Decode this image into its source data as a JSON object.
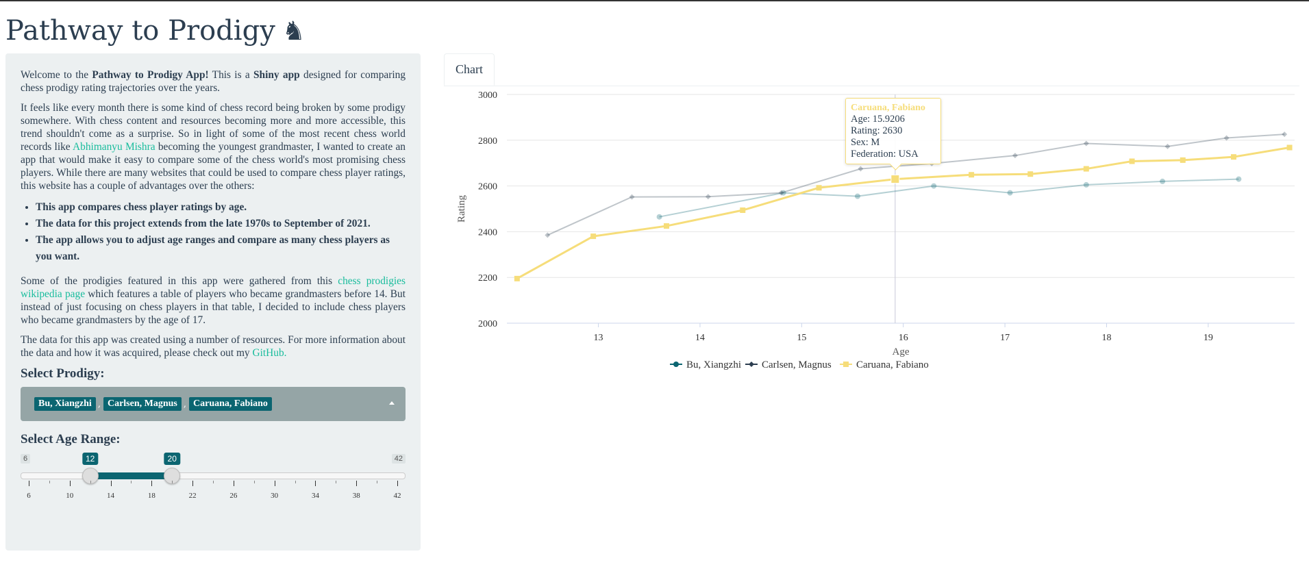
{
  "app": {
    "title": "Pathway to Prodigy",
    "icon": "chess-knight-icon"
  },
  "sidebar": {
    "intro_prefix": "Welcome to the ",
    "intro_app_name": "Pathway to Prodigy App!",
    "intro_mid": " This is a ",
    "intro_shiny": "Shiny app",
    "intro_suffix": " designed for comparing chess prodigy rating trajectories over the years.",
    "para2_before_link": "It feels like every month there is some kind of chess record being broken by some prodigy somewhere. With chess content and resources becoming more and more accessible, this trend shouldn't come as a surprise. So in light of some of the most recent chess world records like ",
    "para2_link": "Abhimanyu Mishra",
    "para2_after_link": " becoming the youngest grandmaster, I wanted to create an app that would make it easy to compare some of the chess world's most promising chess players. While there are many websites that could be used to compare chess player ratings, this website has a couple of advantages over the others:",
    "features": [
      "This app compares chess player ratings by age.",
      "The data for this project extends from the late 1970s to September of 2021.",
      "The app allows you to adjust age ranges and compare as many chess players as you want."
    ],
    "para3_before_link": "Some of the prodigies featured in this app were gathered from this ",
    "para3_link": "chess prodigies wikipedia page",
    "para3_after_link": " which features a table of players who became grandmasters before 14. But instead of just focusing on chess players in that table, I decided to include chess players who became grandmasters by the age of 17.",
    "para4_text": "The data for this app was created using a number of resources. For more information about the data and how it was acquired, please check out my ",
    "para4_link": "GitHub.",
    "select_prodigy_label": "Select Prodigy:",
    "selected_prodigies": [
      "Bu, Xiangzhi",
      "Carlsen, Magnus",
      "Caruana, Fabiano"
    ],
    "age_range_label": "Select Age Range:",
    "age_slider": {
      "min": 6,
      "max": 42,
      "from": 12,
      "to": 20,
      "min_label": "6",
      "max_label": "42",
      "from_label": "12",
      "to_label": "20",
      "tick_labels": [
        "6",
        "10",
        "14",
        "18",
        "22",
        "26",
        "30",
        "34",
        "38",
        "42"
      ]
    }
  },
  "tabs": {
    "chart_label": "Chart"
  },
  "tooltip": {
    "name": "Caruana, Fabiano",
    "age": "Age: 15.9206",
    "rating": "Rating: 2630",
    "sex": "Sex: M",
    "federation": "Federation: USA"
  },
  "chart_data": {
    "type": "line",
    "xlabel": "Age",
    "ylabel": "Rating",
    "xlim": [
      12.1,
      19.85
    ],
    "ylim": [
      2000,
      3000
    ],
    "x_ticks": [
      "13",
      "14",
      "15",
      "16",
      "17",
      "18",
      "19"
    ],
    "y_ticks": [
      "2000",
      "2200",
      "2400",
      "2600",
      "2800",
      "3000"
    ],
    "legend_position": "bottom",
    "series": [
      {
        "name": "Bu, Xiangzhi",
        "color": "#0b6571",
        "marker": "circle",
        "faded": true,
        "points": [
          [
            13.6,
            2465
          ],
          [
            14.82,
            2570
          ],
          [
            15.55,
            2555
          ],
          [
            16.3,
            2600
          ],
          [
            17.05,
            2570
          ],
          [
            17.8,
            2605
          ],
          [
            18.55,
            2620
          ],
          [
            19.3,
            2630
          ]
        ]
      },
      {
        "name": "Carlsen, Magnus",
        "color": "#2c3e50",
        "marker": "diamond",
        "faded": true,
        "points": [
          [
            12.5,
            2385
          ],
          [
            13.33,
            2552
          ],
          [
            14.08,
            2553
          ],
          [
            14.8,
            2570
          ],
          [
            15.58,
            2675
          ],
          [
            16.28,
            2698
          ],
          [
            17.1,
            2733
          ],
          [
            17.8,
            2786
          ],
          [
            18.6,
            2773
          ],
          [
            19.18,
            2810
          ],
          [
            19.75,
            2826
          ]
        ]
      },
      {
        "name": "Caruana, Fabiano",
        "color": "#f6dd7a",
        "marker": "square",
        "faded": false,
        "points": [
          [
            12.2,
            2195
          ],
          [
            12.95,
            2380
          ],
          [
            13.67,
            2425
          ],
          [
            14.42,
            2494
          ],
          [
            15.17,
            2592
          ],
          [
            15.92,
            2630
          ],
          [
            16.67,
            2649
          ],
          [
            17.25,
            2652
          ],
          [
            17.8,
            2675
          ],
          [
            18.25,
            2708
          ],
          [
            18.75,
            2713
          ],
          [
            19.25,
            2727
          ],
          [
            19.8,
            2768
          ]
        ]
      }
    ],
    "hover_x": 15.92
  }
}
